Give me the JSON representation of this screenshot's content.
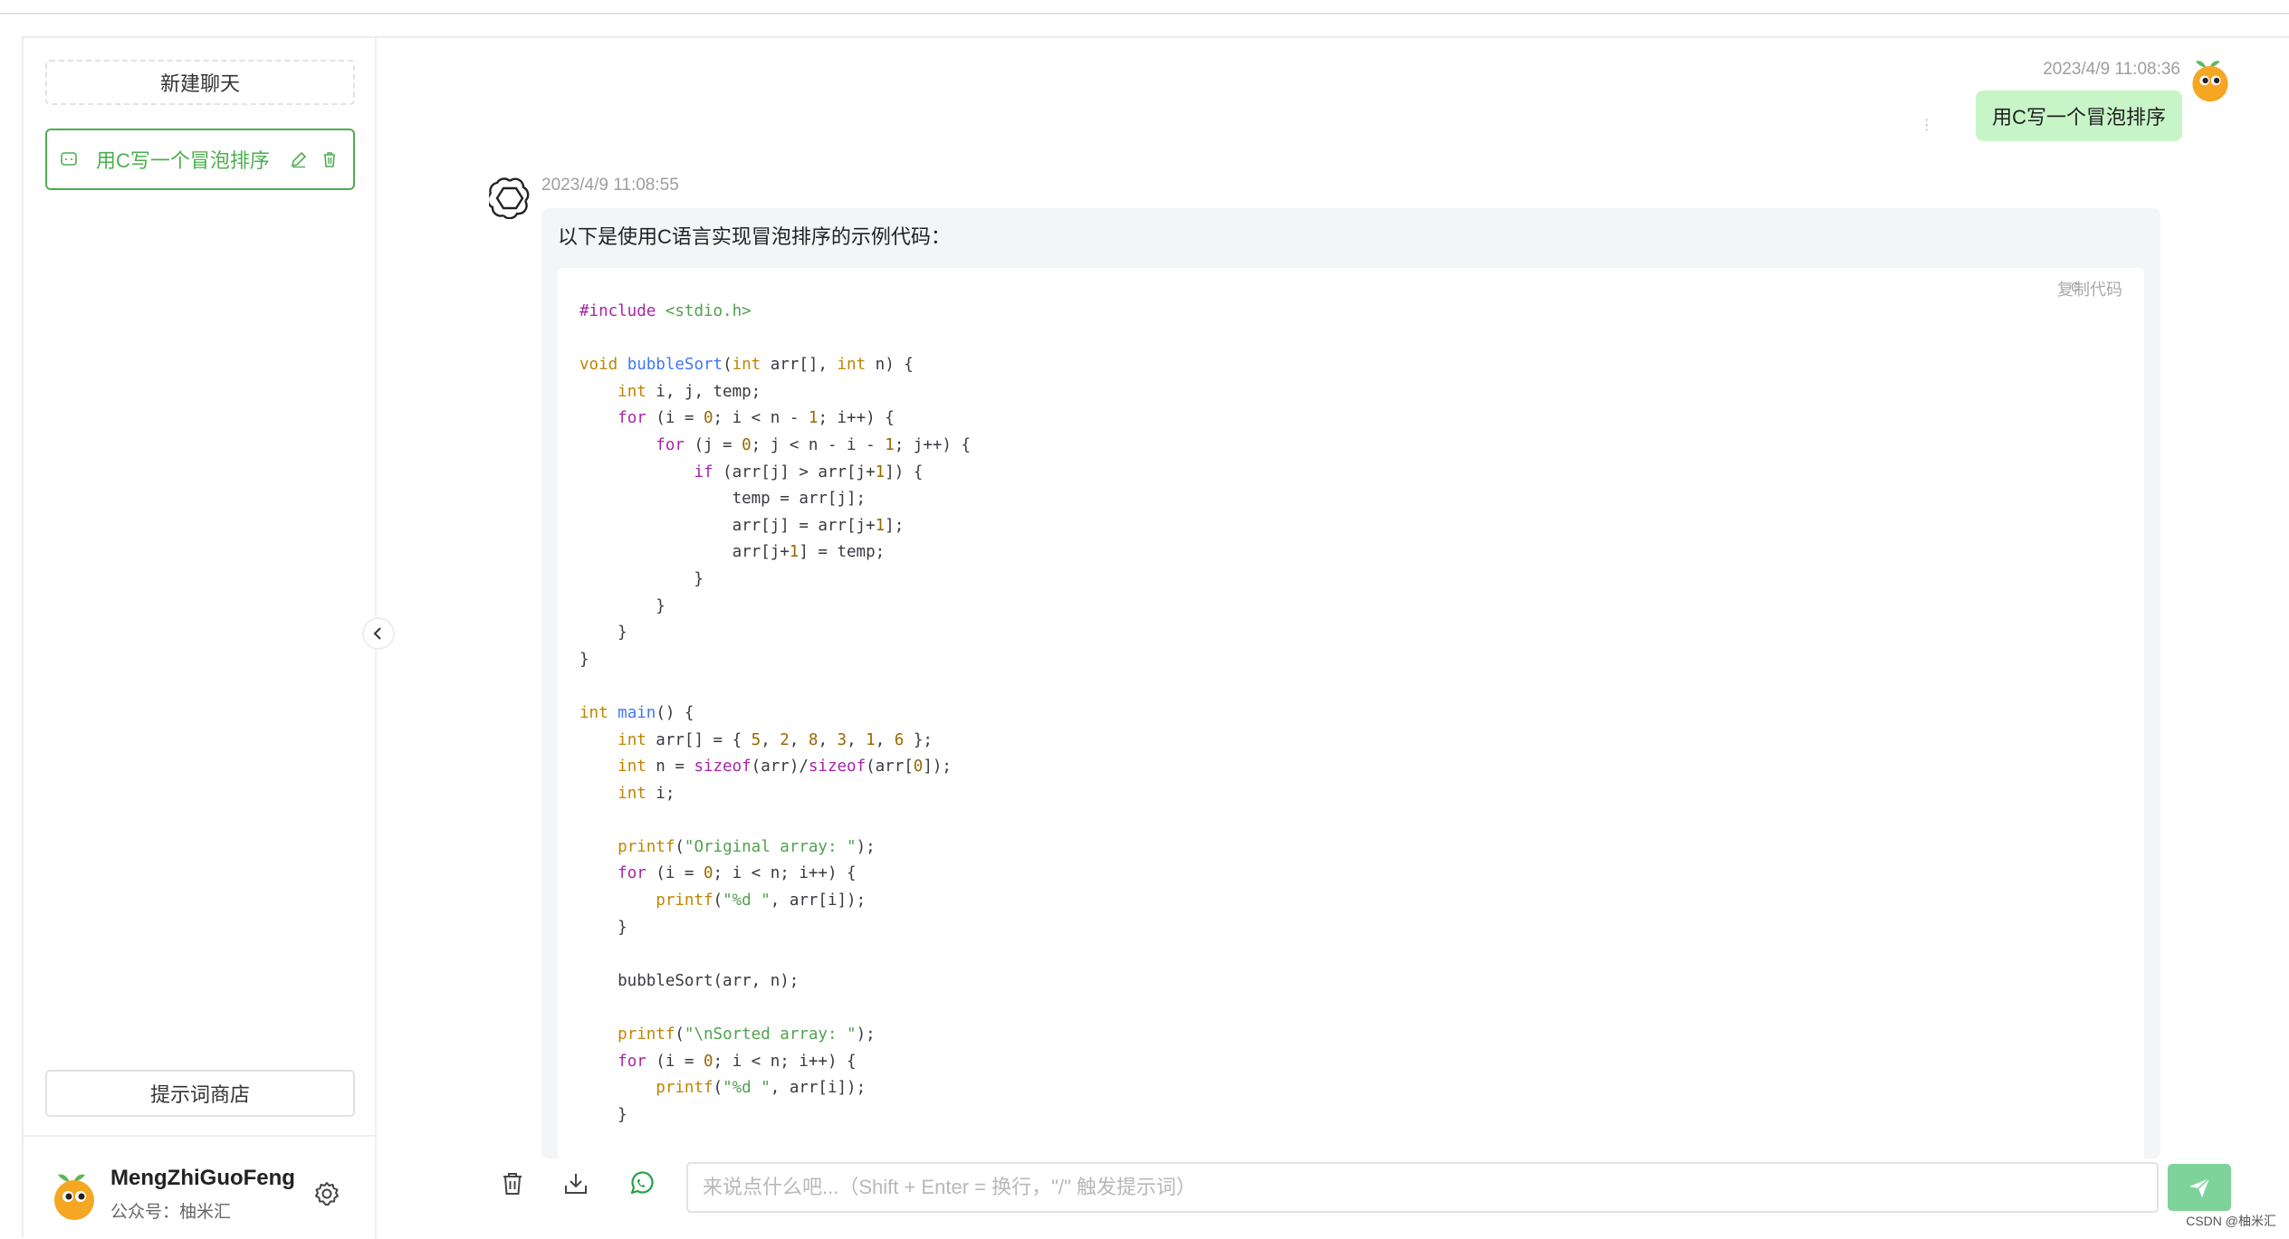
{
  "sidebar": {
    "new_chat_label": "新建聊天",
    "history": [
      {
        "label": "用C写一个冒泡排序",
        "active": true
      }
    ],
    "prompt_store_label": "提示词商店",
    "user": {
      "name": "MengZhiGuoFeng",
      "description": "公众号：柚米汇"
    }
  },
  "conversation": {
    "user_message": {
      "time": "2023/4/9 11:08:36",
      "text": "用C写一个冒泡排序"
    },
    "bot_message": {
      "time": "2023/4/9 11:08:55",
      "intro": "以下是使用C语言实现冒泡排序的示例代码：",
      "code_language": "c",
      "copy_label": "复制代码"
    }
  },
  "input": {
    "placeholder": "来说点什么吧...（Shift + Enter = 换行，\"/\" 触发提示词）",
    "value": ""
  },
  "watermark": "CSDN @柚米汇",
  "colors": {
    "accent": "#4caf50",
    "user_bubble": "#c8f5c8",
    "send_button": "#7ed39a"
  }
}
